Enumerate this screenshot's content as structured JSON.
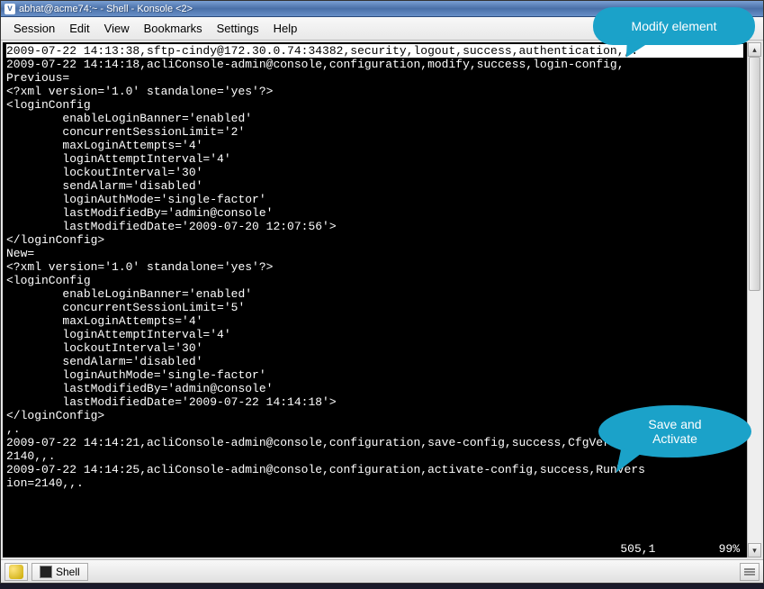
{
  "window": {
    "title": "abhat@acme74:~ - Shell - Konsole <2>"
  },
  "menubar": {
    "items": [
      "Session",
      "Edit",
      "View",
      "Bookmarks",
      "Settings",
      "Help"
    ]
  },
  "terminal": {
    "lines": [
      {
        "inverse": true,
        "text": "2009-07-22 14:13:38,sftp-cindy@172.30.0.74:34382,security,logout,success,authentication,,."
      },
      {
        "text": "2009-07-22 14:14:18,acliConsole-admin@console,configuration,modify,success,login-config,"
      },
      {
        "text": "Previous="
      },
      {
        "text": "<?xml version='1.0' standalone='yes'?>"
      },
      {
        "text": "<loginConfig"
      },
      {
        "text": "        enableLoginBanner='enabled'"
      },
      {
        "text": "        concurrentSessionLimit='2'"
      },
      {
        "text": "        maxLoginAttempts='4'"
      },
      {
        "text": "        loginAttemptInterval='4'"
      },
      {
        "text": "        lockoutInterval='30'"
      },
      {
        "text": "        sendAlarm='disabled'"
      },
      {
        "text": "        loginAuthMode='single-factor'"
      },
      {
        "text": "        lastModifiedBy='admin@console'"
      },
      {
        "text": "        lastModifiedDate='2009-07-20 12:07:56'>"
      },
      {
        "text": "</loginConfig>"
      },
      {
        "text": ""
      },
      {
        "text": "New="
      },
      {
        "text": "<?xml version='1.0' standalone='yes'?>"
      },
      {
        "text": "<loginConfig"
      },
      {
        "text": "        enableLoginBanner='enabled'"
      },
      {
        "text": "        concurrentSessionLimit='5'"
      },
      {
        "text": "        maxLoginAttempts='4'"
      },
      {
        "text": "        loginAttemptInterval='4'"
      },
      {
        "text": "        lockoutInterval='30'"
      },
      {
        "text": "        sendAlarm='disabled'"
      },
      {
        "text": "        loginAuthMode='single-factor'"
      },
      {
        "text": "        lastModifiedBy='admin@console'"
      },
      {
        "text": "        lastModifiedDate='2009-07-22 14:14:18'>"
      },
      {
        "text": "</loginConfig>"
      },
      {
        "text": ",."
      },
      {
        "text": "2009-07-22 14:14:21,acliConsole-admin@console,configuration,save-config,success,CfgVersion="
      },
      {
        "text": "2140,,."
      },
      {
        "text": "2009-07-22 14:14:25,acliConsole-admin@console,configuration,activate-config,success,RunVers"
      },
      {
        "text": "ion=2140,,."
      }
    ],
    "status_pos": "505,1",
    "status_pct": "99%"
  },
  "taskbar": {
    "shell_label": "Shell"
  },
  "callouts": {
    "modify": "Modify element",
    "save": "Save and\nActivate"
  }
}
